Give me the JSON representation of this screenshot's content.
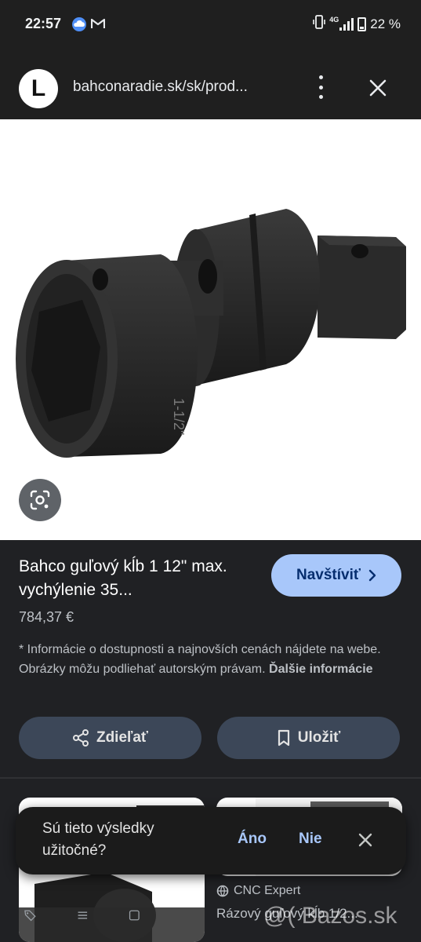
{
  "status_bar": {
    "time": "22:57",
    "battery": "22 %",
    "network": "4G"
  },
  "browser": {
    "logo_letter": "L",
    "url": "bahconaradie.sk/sk/prod..."
  },
  "product": {
    "title": "Bahco guľový kĺb 1 12\" max. vychýlenie 35...",
    "price": "784,37 €",
    "image_marking": "1-1/2\"",
    "visit_label": "Navštíviť",
    "disclaimer": "* Informácie o dostupnosti a najnovších cenách nájdete na webe. Obrázky môžu podliehať autorským právam.",
    "more_info": "Ďalšie informácie",
    "share_label": "Zdieľať",
    "save_label": "Uložiť"
  },
  "feedback": {
    "question": "Sú tieto výsledky užitočné?",
    "yes": "Áno",
    "no": "Nie"
  },
  "related": {
    "source": "CNC Expert",
    "title": "Rázový guľový kĺb 1/2..."
  },
  "watermark": "@( Bazos.sk",
  "colors": {
    "background": "#202124",
    "accent_button": "#a8c7fa",
    "tonal_button": "#3c4758"
  }
}
